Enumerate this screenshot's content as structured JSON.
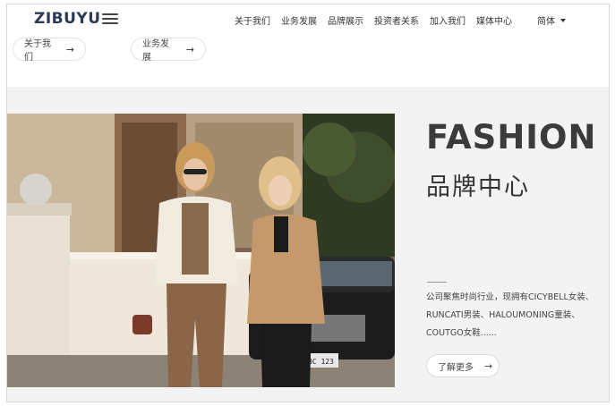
{
  "header": {
    "logo": "ZIBUYU",
    "nav": [
      "关于我们",
      "业务发展",
      "品牌展示",
      "投资者关系",
      "加入我们",
      "媒体中心"
    ],
    "lang": "简体"
  },
  "quick_links": [
    {
      "label": "关于我们",
      "arrow": "→"
    },
    {
      "label": "业务发展",
      "arrow": "→"
    }
  ],
  "hero": {
    "title": "FASHION",
    "subtitle": "品牌中心",
    "description": "公司聚焦时尚行业，现拥有CICYBELL女装、RUNCATI男装、HALOUMONING童装、COUTGO女鞋......",
    "more_label": "了解更多",
    "more_arrow": "→",
    "plate_text": "BC 123"
  }
}
